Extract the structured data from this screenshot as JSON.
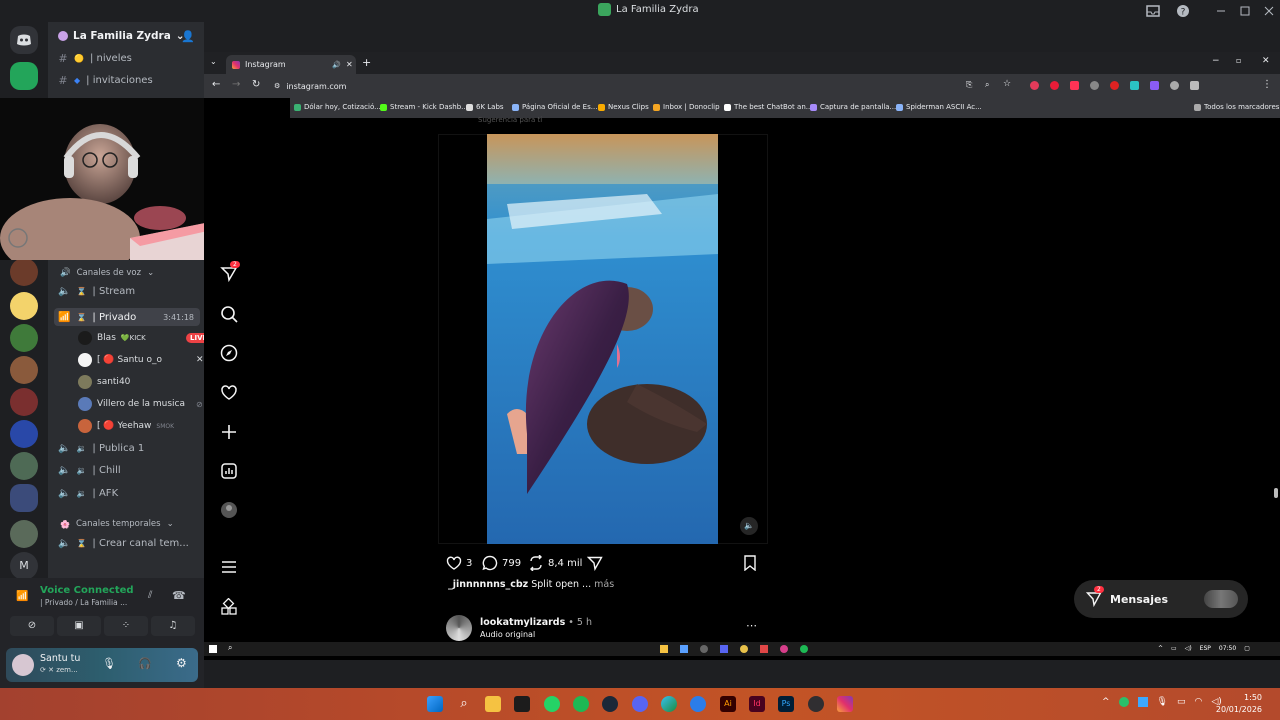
{
  "window": {
    "title": "La Familia Zydra"
  },
  "server": {
    "name": "La Familia Zydra"
  },
  "channels": {
    "top": [
      {
        "label": "| niveles"
      },
      {
        "label": "| invitaciones"
      }
    ],
    "voice_category": "Canales de voz",
    "voice": [
      {
        "label": "| Stream"
      },
      {
        "label": "| Privado",
        "timer": "3:41:18"
      },
      {
        "label": "| Publica 1"
      },
      {
        "label": "| Chill"
      },
      {
        "label": "| AFK"
      }
    ],
    "voice_users": [
      {
        "name": "Blas",
        "badge": "KICK",
        "live": "LIVE"
      },
      {
        "name": "[ 🔴 Santu o_o"
      },
      {
        "name": "santi40"
      },
      {
        "name": "Villero de la musica"
      },
      {
        "name": "[ 🔴 Yeehaw",
        "tag": "SMOK"
      }
    ],
    "temp_category": "Canales temporales",
    "temp": [
      {
        "label": "| Crear canal tem..."
      }
    ]
  },
  "voice_status": {
    "title": "Voice Connected",
    "sub": "| Privado / La Familia ..."
  },
  "user": {
    "name": "Santu tu",
    "status": "zem..."
  },
  "browser": {
    "tab_title": "Instagram",
    "url": "instagram.com",
    "bookmarks": [
      "Dólar hoy, Cotizació...",
      "Stream - Kick Dashb...",
      "6K Labs",
      "Página Oficial de Es...",
      "Nexus Clips",
      "Inbox | Donoclip",
      "The best ChatBot an...",
      "Captura de pantalla...",
      "Spiderman ASCII Ac...",
      "Todos los marcadores"
    ]
  },
  "instagram": {
    "notif_count": "2",
    "top_hint": "Sugerencia para ti",
    "post": {
      "likes": "3",
      "comments": "799",
      "reposts": "8,4 mil",
      "caption_user": "_jinnnnnns_cbz",
      "caption_text": "Split open ...",
      "more": "más"
    },
    "next_post": {
      "user": "lookatmylizards",
      "time": "• 5 h",
      "audio": "Audio original"
    },
    "messages": {
      "label": "Mensajes",
      "count": "2"
    }
  },
  "inner_tray": {
    "lang": "ESP",
    "time": "07:50"
  },
  "system_clock": {
    "time": "1:50",
    "date": "20/01/2026"
  },
  "colors": {
    "discord_bg": "#1e1f22",
    "sidebar": "#2b2d31",
    "live": "#ed4245",
    "ig_bg": "#000000",
    "taskbar": "#b5492a"
  }
}
